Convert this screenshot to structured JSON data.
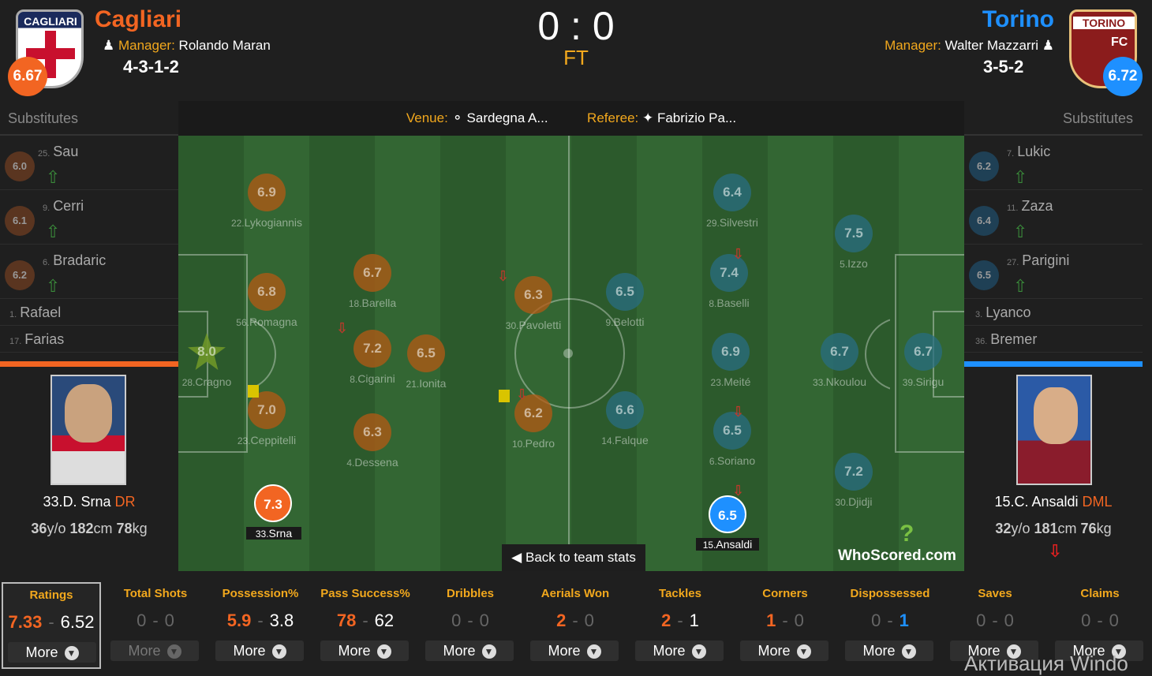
{
  "home": {
    "name": "Cagliari",
    "crest_text": "CAGLIARI",
    "rating": "6.67",
    "manager_label": "Manager:",
    "manager": "Rolando Maran",
    "formation": "4-3-1-2",
    "color": "#f26522"
  },
  "away": {
    "name": "Torino",
    "crest_text": "TORINO",
    "crest_text2": "FC",
    "rating": "6.72",
    "manager_label": "Manager:",
    "manager": "Walter Mazzarri",
    "formation": "3-5-2",
    "color": "#1e90ff"
  },
  "score": "0 : 0",
  "status": "FT",
  "venue_label": "Venue:",
  "venue": "Sardegna A...",
  "referee_label": "Referee:",
  "referee": "Fabrizio Pa...",
  "substitutes_label": "Substitutes",
  "home_subs": [
    {
      "num": "25.",
      "name": "Sau",
      "rating": "6.0"
    },
    {
      "num": "9.",
      "name": "Cerri",
      "rating": "6.1"
    },
    {
      "num": "6.",
      "name": "Bradaric",
      "rating": "6.2"
    }
  ],
  "home_bench": [
    {
      "num": "1.",
      "name": "Rafael"
    },
    {
      "num": "17.",
      "name": "Farias"
    }
  ],
  "away_subs": [
    {
      "num": "7.",
      "name": "Lukic",
      "rating": "6.2"
    },
    {
      "num": "11.",
      "name": "Zaza",
      "rating": "6.4"
    },
    {
      "num": "27.",
      "name": "Parigini",
      "rating": "6.5"
    }
  ],
  "away_bench": [
    {
      "num": "3.",
      "name": "Lyanco"
    },
    {
      "num": "36.",
      "name": "Bremer"
    }
  ],
  "home_player": {
    "name": "33.D. Srna",
    "pos": "DR",
    "age": "36",
    "age_u": "y/o",
    "height": "182",
    "height_u": "cm",
    "weight": "78",
    "weight_u": "kg"
  },
  "away_player": {
    "name": "15.C. Ansaldi",
    "pos": "DML",
    "age": "32",
    "age_u": "y/o",
    "height": "181",
    "height_u": "cm",
    "weight": "76",
    "weight_u": "kg"
  },
  "pitch_players": {
    "cragno": {
      "r": "8.0",
      "n": "28.",
      "l": "Cragno"
    },
    "lykogiannis": {
      "r": "6.9",
      "n": "22.",
      "l": "Lykogiannis"
    },
    "romagna": {
      "r": "6.8",
      "n": "56.",
      "l": "Romagna"
    },
    "ceppitelli": {
      "r": "7.0",
      "n": "23.",
      "l": "Ceppitelli"
    },
    "srna": {
      "r": "7.3",
      "n": "33.",
      "l": "Srna"
    },
    "barella": {
      "r": "6.7",
      "n": "18.",
      "l": "Barella"
    },
    "cigarini": {
      "r": "7.2",
      "n": "8.",
      "l": "Cigarini"
    },
    "dessena": {
      "r": "6.3",
      "n": "4.",
      "l": "Dessena"
    },
    "ionita": {
      "r": "6.5",
      "n": "21.",
      "l": "Ionita"
    },
    "pavoletti": {
      "r": "6.3",
      "n": "30.",
      "l": "Pavoletti"
    },
    "pedro": {
      "r": "6.2",
      "n": "10.",
      "l": "Pedro"
    },
    "belotti": {
      "r": "6.5",
      "n": "9.",
      "l": "Belotti"
    },
    "falque": {
      "r": "6.6",
      "n": "14.",
      "l": "Falque"
    },
    "silvestri": {
      "r": "6.4",
      "n": "29.",
      "l": "Silvestri"
    },
    "baselli": {
      "r": "7.4",
      "n": "8.",
      "l": "Baselli"
    },
    "meite": {
      "r": "6.9",
      "n": "23.",
      "l": "Meité"
    },
    "soriano": {
      "r": "6.5",
      "n": "6.",
      "l": "Soriano"
    },
    "ansaldi": {
      "r": "6.5",
      "n": "15.",
      "l": "Ansaldi"
    },
    "izzo": {
      "r": "7.5",
      "n": "5.",
      "l": "Izzo"
    },
    "nkoulou": {
      "r": "6.7",
      "n": "33.",
      "l": "Nkoulou"
    },
    "djidji": {
      "r": "7.2",
      "n": "30.",
      "l": "Djidji"
    },
    "sirigu": {
      "r": "6.7",
      "n": "39.",
      "l": "Sirigu"
    }
  },
  "back_label": "Back to team stats",
  "logo_text": "WhoScored.com",
  "stats": [
    {
      "title": "Ratings",
      "a": "7.33",
      "b": "6.52",
      "more": "More"
    },
    {
      "title": "Total Shots",
      "a": "0",
      "b": "0",
      "more": "More"
    },
    {
      "title": "Possession%",
      "a": "5.9",
      "b": "3.8",
      "more": "More"
    },
    {
      "title": "Pass Success%",
      "a": "78",
      "b": "62",
      "more": "More"
    },
    {
      "title": "Dribbles",
      "a": "0",
      "b": "0",
      "more": "More"
    },
    {
      "title": "Aerials Won",
      "a": "2",
      "b": "0",
      "more": "More"
    },
    {
      "title": "Tackles",
      "a": "2",
      "b": "1",
      "more": "More"
    },
    {
      "title": "Corners",
      "a": "1",
      "b": "0",
      "more": "More"
    },
    {
      "title": "Dispossessed",
      "a": "0",
      "b": "1",
      "more": "More"
    },
    {
      "title": "Saves",
      "a": "0",
      "b": "0",
      "more": "More"
    },
    {
      "title": "Claims",
      "a": "0",
      "b": "0",
      "more": "More"
    }
  ],
  "stat_sep": "-",
  "activate_text": "Активация Windo"
}
